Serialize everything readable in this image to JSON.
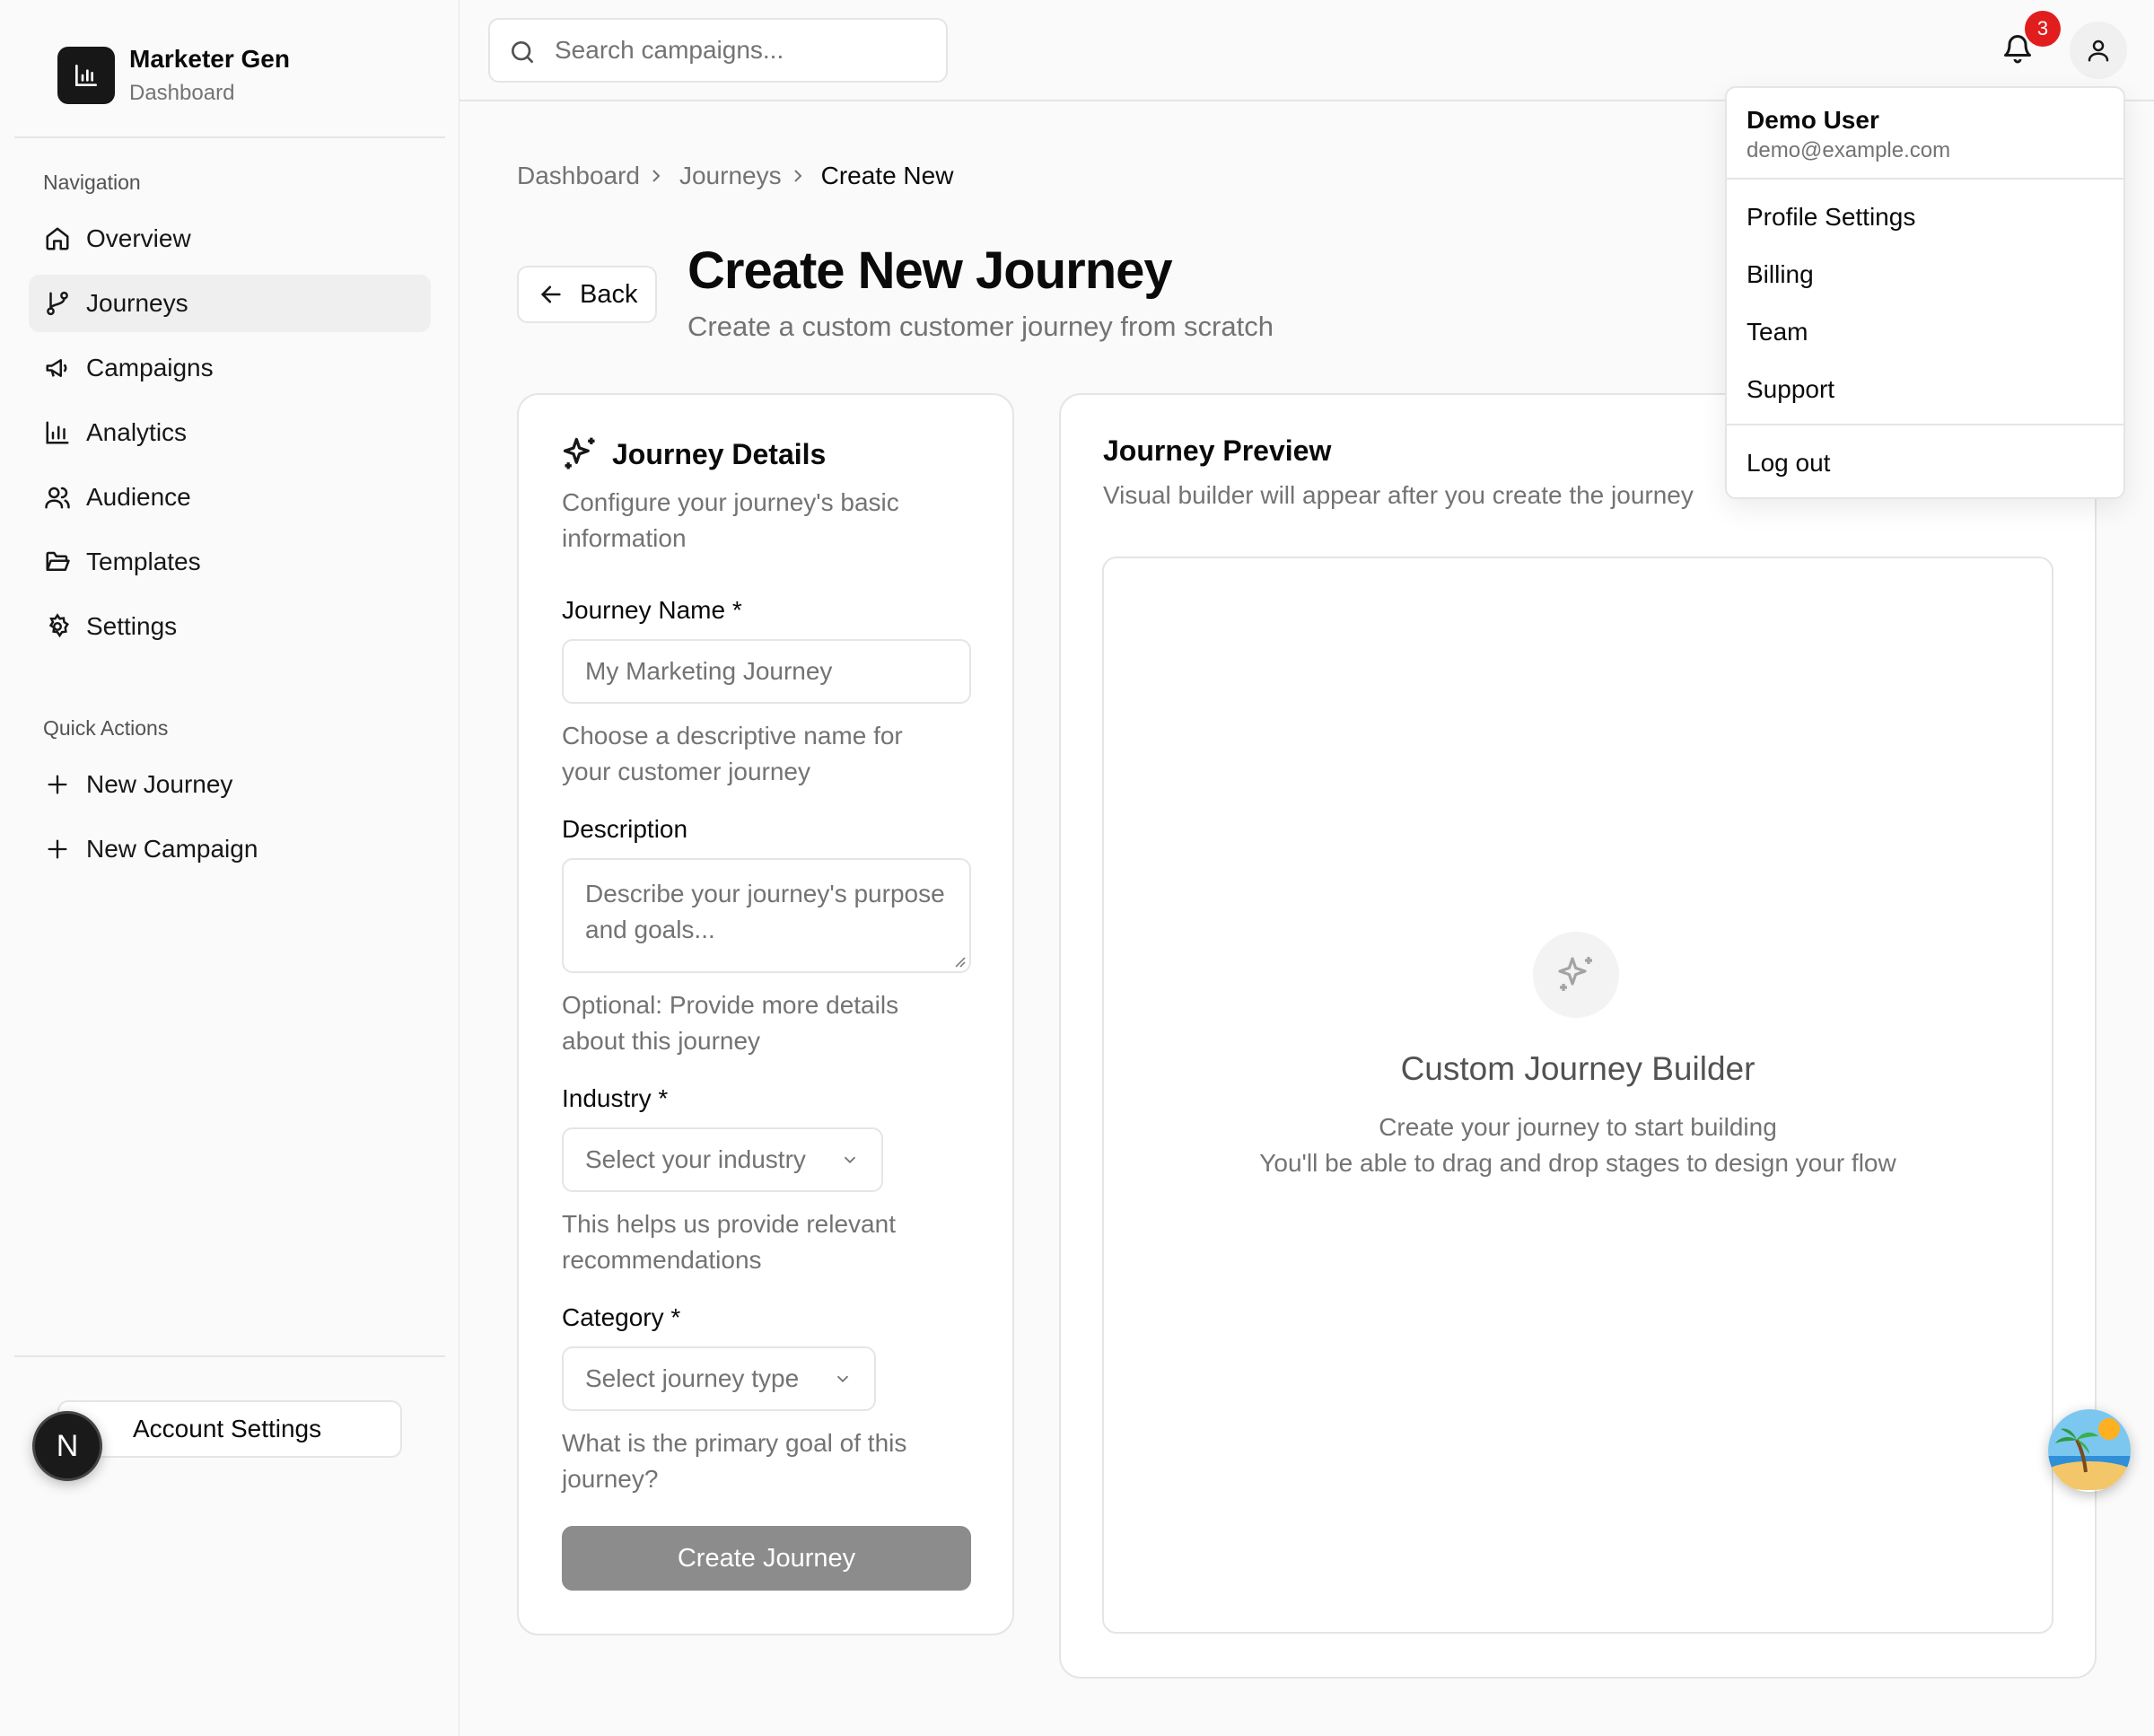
{
  "brand": {
    "name": "Marketer Gen",
    "subtitle": "Dashboard"
  },
  "sidebar": {
    "nav_label": "Navigation",
    "items": [
      {
        "label": "Overview",
        "icon": "home-icon"
      },
      {
        "label": "Journeys",
        "icon": "git-branch-icon",
        "active": true
      },
      {
        "label": "Campaigns",
        "icon": "megaphone-icon"
      },
      {
        "label": "Analytics",
        "icon": "bar-chart-icon"
      },
      {
        "label": "Audience",
        "icon": "users-icon"
      },
      {
        "label": "Templates",
        "icon": "folder-open-icon"
      },
      {
        "label": "Settings",
        "icon": "gear-icon"
      }
    ],
    "quick_label": "Quick Actions",
    "quick": [
      {
        "label": "New Journey",
        "icon": "plus-icon"
      },
      {
        "label": "New Campaign",
        "icon": "plus-icon"
      }
    ],
    "account_settings": "Account Settings",
    "dev_badge": "N"
  },
  "header": {
    "search_placeholder": "Search campaigns...",
    "notification_count": "3"
  },
  "user_menu": {
    "name": "Demo User",
    "email": "demo@example.com",
    "items": [
      "Profile Settings",
      "Billing",
      "Team",
      "Support"
    ],
    "logout": "Log out"
  },
  "breadcrumb": [
    "Dashboard",
    "Journeys",
    "Create New"
  ],
  "page": {
    "back": "Back",
    "title": "Create New Journey",
    "subtitle": "Create a custom customer journey from scratch"
  },
  "form": {
    "title": "Journey Details",
    "description": "Configure your journey's basic information",
    "name_label": "Journey Name *",
    "name_placeholder": "My Marketing Journey",
    "name_help": "Choose a descriptive name for your customer journey",
    "desc_label": "Description",
    "desc_placeholder": "Describe your journey's purpose and goals...",
    "desc_help": "Optional: Provide more details about this journey",
    "industry_label": "Industry *",
    "industry_value": "Select your industry",
    "industry_help": "This helps us provide relevant recommendations",
    "category_label": "Category *",
    "category_value": "Select journey type",
    "category_help": "What is the primary goal of this journey?",
    "submit": "Create Journey"
  },
  "preview": {
    "title": "Journey Preview",
    "description": "Visual builder will appear after you create the journey",
    "builder_title": "Custom Journey Builder",
    "builder_line1": "Create your journey to start building",
    "builder_line2": "You'll be able to drag and drop stages to design your flow"
  },
  "colors": {
    "accent": "#171717",
    "badge": "#e11d1d",
    "disabled_button": "#8c8c8c"
  }
}
